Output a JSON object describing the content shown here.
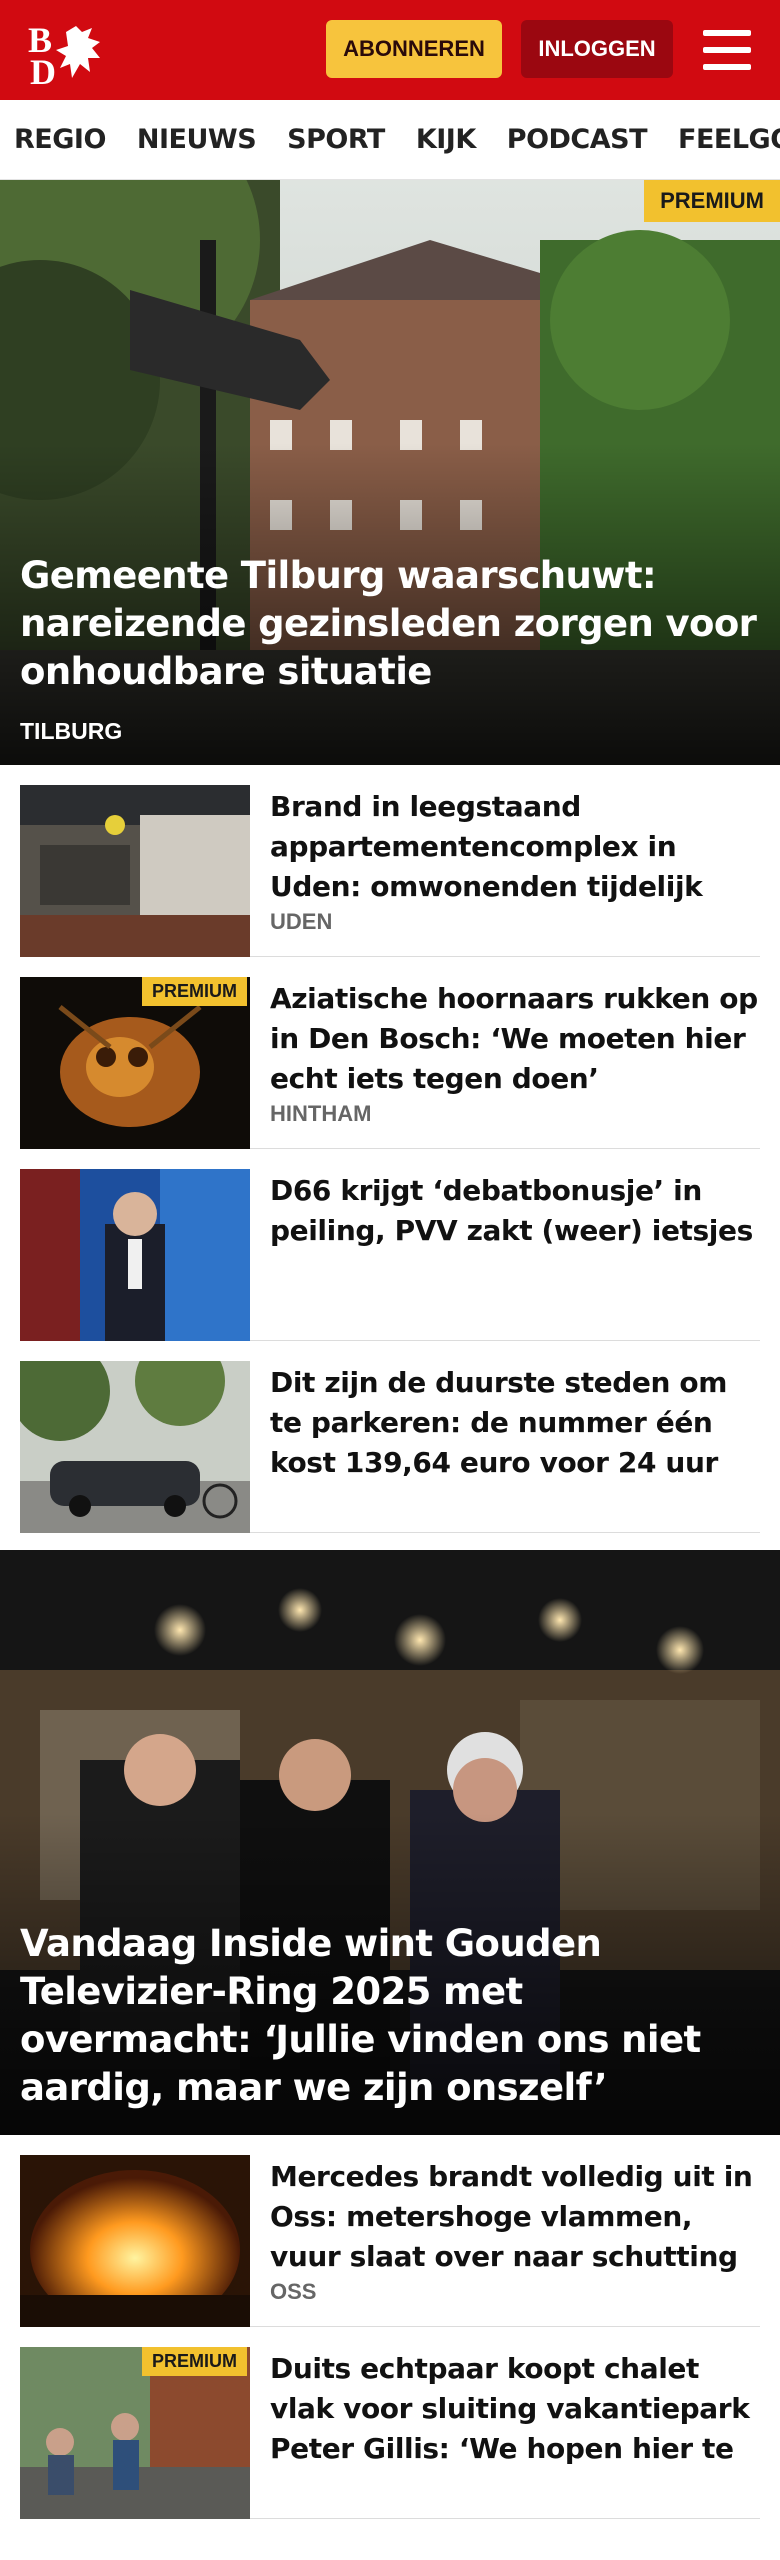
{
  "header": {
    "logo_text": "BD",
    "subscribe_label": "ABONNEREN",
    "login_label": "INLOGGEN",
    "menu_icon": "hamburger-menu-icon",
    "brand_color": "#d10a11"
  },
  "nav": {
    "items": [
      "REGIO",
      "NIEUWS",
      "SPORT",
      "KIJK",
      "PODCAST",
      "FEELGOOD"
    ]
  },
  "hero": {
    "badge": "PREMIUM",
    "title": "Gemeente Tilburg waarschuwt: nareizende gezinsleden zorgen voor onhoudbare situatie",
    "location": "TILBURG"
  },
  "articles": [
    {
      "title": "Brand in leegstaand appartementencomplex in Uden: omwonenden tijdelijk geëvacu-...",
      "location": "UDEN",
      "premium": ""
    },
    {
      "title": "Aziatische hoornaars rukken op in Den Bosch: ‘We moeten hier echt iets tegen doen’",
      "location": "HINTHAM",
      "premium": "PREMIUM"
    },
    {
      "title": "D66 krijgt ‘debatbonusje’ in peiling, PVV zakt (weer) ietsjes",
      "location": "",
      "premium": ""
    },
    {
      "title": "Dit zijn de duurste steden om te parkeren: de nummer één kost 139,64 euro voor 24 uur",
      "location": "",
      "premium": ""
    }
  ],
  "feature": {
    "title": "Vandaag Inside wint Gouden Televizier-Ring 2025 met overmacht: ‘Jullie vinden ons niet aardig, maar we zijn onszelf’"
  },
  "articles2": [
    {
      "title": "Mercedes brandt volledig uit in Oss: metershoge vlammen, vuur slaat over naar schutting",
      "location": "OSS",
      "premium": ""
    },
    {
      "title": "Duits echtpaar koopt chalet vlak voor sluiting vakantiepark Peter Gillis: ‘We hopen hier te mogen...",
      "location": "",
      "premium": "PREMIUM"
    }
  ]
}
